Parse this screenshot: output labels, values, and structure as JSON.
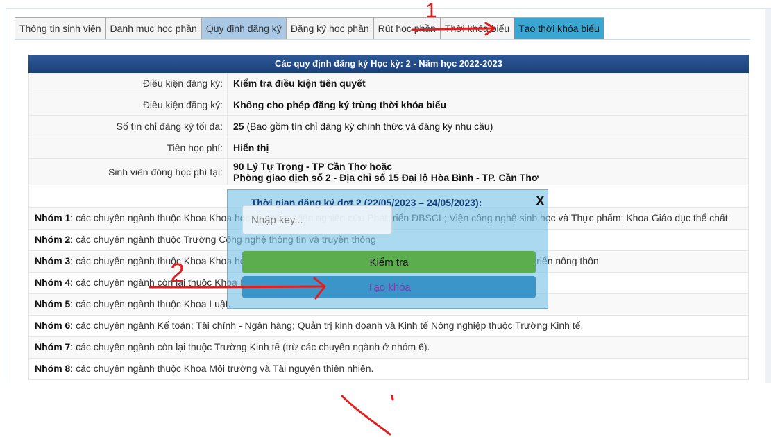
{
  "tabs": [
    {
      "label": "Thông tin sinh viên",
      "state": "normal"
    },
    {
      "label": "Danh mục học phần",
      "state": "normal"
    },
    {
      "label": "Quy định đăng ký",
      "state": "active"
    },
    {
      "label": "Đăng ký học phần",
      "state": "normal"
    },
    {
      "label": "Rút học phần",
      "state": "normal"
    },
    {
      "label": "Thời khóa biểu",
      "state": "normal"
    },
    {
      "label": "Tạo thời khóa biểu",
      "state": "highlight"
    }
  ],
  "panel": {
    "title": "Các quy định đăng ký Học kỳ: 2 - Năm học 2022-2023",
    "rows": [
      {
        "label": "Điều kiện đăng ký:",
        "value": "Kiểm tra điều kiện tiên quyết"
      },
      {
        "label": "Điều kiện đăng ký:",
        "value": "Không cho phép đăng ký trùng thời khóa biểu"
      },
      {
        "label": "Số tín chỉ đăng ký tối đa:",
        "value_bold": "25",
        "value_rest": " (Bao gồm tín chỉ đăng ký chính thức và đăng ký nhu cầu)"
      },
      {
        "label": "Tiền học phí:",
        "value": "Hiển thị"
      },
      {
        "label": "Sinh viên đóng học phí tại:",
        "value_line1": "90 Lý Tự Trọng - TP Cần Thơ hoặc",
        "value_line2": "Phòng giao dịch số 2 - Địa chỉ số 15 Đại lộ Hòa Bình - TP. Cần Thơ"
      }
    ],
    "groups": [
      {
        "name": "Nhóm 1",
        "text": ": các chuyên ngành thuộc Khoa Khoa học tự nhiên; Viện nghiên cứu Phát triển ĐBSCL; Viện công nghệ sinh học và Thực phẩm; Khoa Giáo dục thể chất"
      },
      {
        "name": "Nhóm 2",
        "text": ": các chuyên ngành thuộc Trường Công nghệ thông tin và truyền thông"
      },
      {
        "name": "Nhóm 3",
        "text": ": các chuyên ngành thuộc Khoa Khoa học tự nhiên, ngành Kỹ thuật xây dựng, ngành Luật thuộc Khoa Phát triển nông thôn"
      },
      {
        "name": "Nhóm 4",
        "text": ": các chuyên ngành còn lại thuộc Khoa Phát triển nông thôn (trừ các chuyên ngành ở nhóm 3)."
      },
      {
        "name": "Nhóm 5",
        "text": ": các chuyên ngành thuộc Khoa Luật."
      },
      {
        "name": "Nhóm 6",
        "text": ": các chuyên ngành Kế toán; Tài chính - Ngân hàng; Quản trị kinh doanh và Kinh tế Nông nghiệp thuộc Trường Kinh tế."
      },
      {
        "name": "Nhóm 7",
        "text": ": các chuyên ngành còn lại thuộc Trường Kinh tế (trừ các chuyên ngành ở nhóm 6)."
      },
      {
        "name": "Nhóm 8",
        "text": ": các chuyên ngành thuộc Khoa Môi trường và Tài nguyên thiên nhiên."
      }
    ]
  },
  "modal": {
    "title": "Thời gian đăng ký đợt 2 (22/05/2023 – 24/05/2023):",
    "close": "X",
    "input_placeholder": "Nhập key...",
    "check_button": "Kiểm tra",
    "create_button": "Tạo khóa"
  },
  "annotations": {
    "label_1": "1",
    "label_2": "2",
    "color": "#e02020"
  },
  "colors": {
    "header_blue": "#1b3f78",
    "tab_active": "#a9c9e6",
    "tab_highlight": "#3aa6d2",
    "button_green": "#5cad4d",
    "button_blue": "#3b95c9"
  }
}
